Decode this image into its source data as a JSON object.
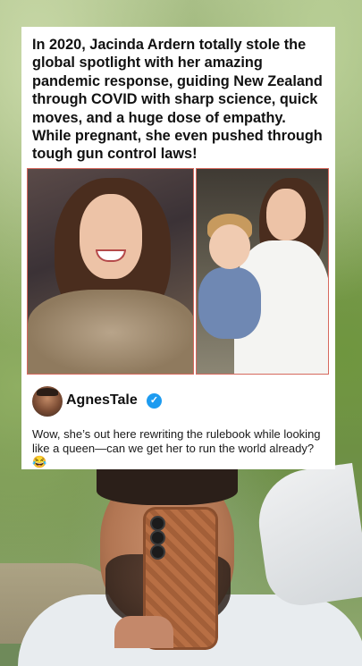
{
  "post": {
    "headline": "In 2020, Jacinda Ardern totally stole the global spotlight with her amazing pandemic response, guiding New Zealand through COVID with sharp science, quick moves, and a huge dose of empathy. While pregnant, she even pushed through tough gun control laws!",
    "author_name": "AgnesTale",
    "comment": "Wow, she’s out here rewriting the rulebook while looking like a queen—can we get her to run the world already? 😂",
    "verified_icon": "verified-check-icon"
  },
  "colors": {
    "card_bg": "#ffffff",
    "photo_border": "#d6695e",
    "verified": "#1d9bf0"
  }
}
